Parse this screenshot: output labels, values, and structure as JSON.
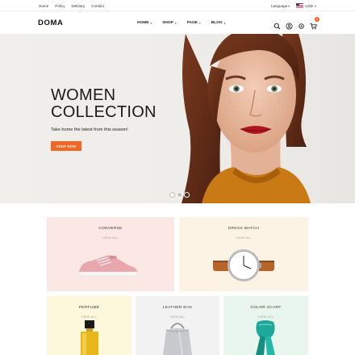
{
  "topbar": {
    "links": [
      "Home",
      "Policy",
      "Delivery",
      "Contact"
    ],
    "language": "Language",
    "currency": "USD"
  },
  "header": {
    "logo": "DOMA",
    "nav": [
      "HOME",
      "SHOP",
      "PAGE",
      "BLOG"
    ],
    "cart_count": "0"
  },
  "hero": {
    "title_line1": "WOMEN",
    "title_line2": "COLLECTION",
    "subtitle": "Take home the latest from this season!",
    "button": "SHOP NOW",
    "slides": 3,
    "active_slide": 1
  },
  "categories": [
    {
      "name": "CONVERSE",
      "view": "VIEW ALL",
      "color": "#fbe7e4"
    },
    {
      "name": "DRESS WATCH",
      "view": "VIEW ALL",
      "color": "#fdf3e4"
    },
    {
      "name": "PERFUME",
      "view": "VIEW ALL",
      "color": "#fdf7dc"
    },
    {
      "name": "LEATHER BAG",
      "view": "VIEW ALL",
      "color": "#f2f2f2"
    },
    {
      "name": "COLOR SCARF",
      "view": "VIEW ALL",
      "color": "#e9f6ee"
    }
  ],
  "colors": {
    "accent": "#f26522"
  }
}
